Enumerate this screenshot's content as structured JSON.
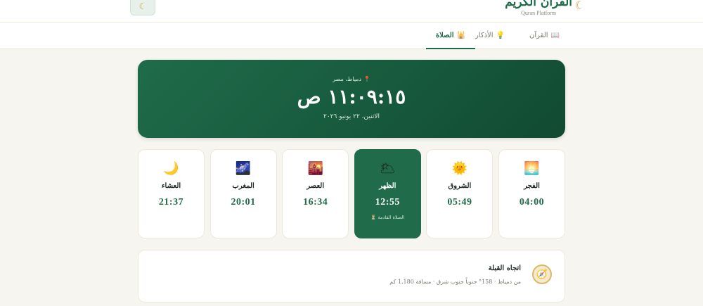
{
  "app": {
    "logo_title": "القرآن الكريم",
    "logo_subtitle": "Quran Platform",
    "theme_icon": "moon-icon"
  },
  "tabs": [
    {
      "label": "القرآن",
      "icon": "book-icon",
      "active": false
    },
    {
      "label": "الأذكار",
      "icon": "lamp-icon",
      "active": false
    },
    {
      "label": "الصلاة",
      "icon": "mosque-icon",
      "active": true
    }
  ],
  "hero": {
    "location": "دمياط، مصر",
    "time": "١١:٠٩:١٥ ص",
    "date": "الاثنين، ٢٢ يونيو ٢٠٢٦"
  },
  "prayers": [
    {
      "name": "الفجر",
      "time": "04:00",
      "icon": "sunrise-icon"
    },
    {
      "name": "الشروق",
      "time": "05:49",
      "icon": "sun-icon"
    },
    {
      "name": "الظهر",
      "time": "12:55",
      "icon": "cloud-sun-icon",
      "active": true,
      "note": "الصلاة القادمة ⏳"
    },
    {
      "name": "العصر",
      "time": "16:34",
      "icon": "sunset-icon"
    },
    {
      "name": "المغرب",
      "time": "20:01",
      "icon": "night-icon"
    },
    {
      "name": "العشاء",
      "time": "21:37",
      "icon": "crescent-icon"
    }
  ],
  "qibla": {
    "title": "اتجاه القبلة",
    "subtitle": "من دمياط · 158° جنوباً جنوب شرق · مسافة 1,180 كم"
  },
  "colors": {
    "primary": "#1f6b4a",
    "accent": "#c9a646",
    "background": "#f7f5ef"
  }
}
